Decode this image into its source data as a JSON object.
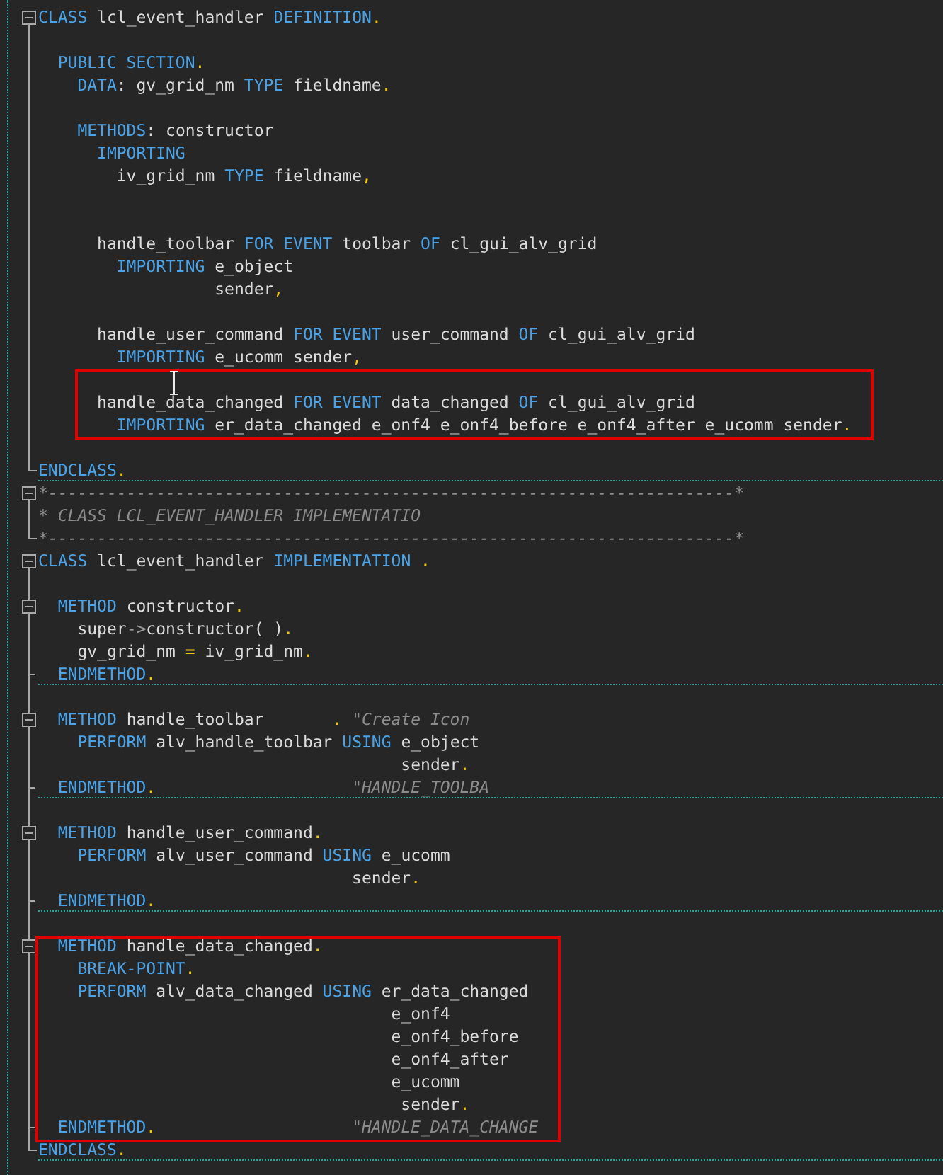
{
  "blocks": [
    {
      "highlighted": false,
      "lines": [
        {
          "kind": "start",
          "separator": false,
          "tokens": [
            {
              "kind": "kw",
              "text": "CLASS"
            },
            {
              "kind": "id",
              "text": " lcl_event_handler "
            },
            {
              "kind": "kw",
              "text": "DEFINITION"
            },
            {
              "kind": "p",
              "text": "."
            }
          ]
        },
        {
          "kind": "line",
          "separator": false
        },
        {
          "kind": "line",
          "separator": false,
          "tokens": [
            {
              "kind": "kw",
              "text": "  PUBLIC SECTION"
            },
            {
              "kind": "p",
              "text": "."
            }
          ]
        },
        {
          "kind": "line",
          "separator": false,
          "tokens": [
            {
              "kind": "kw",
              "text": "    DATA"
            },
            {
              "kind": "id",
              "text": ": gv_grid_nm "
            },
            {
              "kind": "kw",
              "text": "TYPE"
            },
            {
              "kind": "id",
              "text": " fieldname"
            },
            {
              "kind": "p",
              "text": "."
            }
          ]
        },
        {
          "kind": "line",
          "separator": false
        },
        {
          "kind": "line",
          "separator": false,
          "tokens": [
            {
              "kind": "kw",
              "text": "    METHODS"
            },
            {
              "kind": "id",
              "text": ": constructor"
            }
          ]
        },
        {
          "kind": "line",
          "separator": false,
          "tokens": [
            {
              "kind": "kw",
              "text": "      IMPORTING"
            }
          ]
        },
        {
          "kind": "line",
          "separator": false,
          "tokens": [
            {
              "kind": "id",
              "text": "        iv_grid_nm "
            },
            {
              "kind": "kw",
              "text": "TYPE"
            },
            {
              "kind": "id",
              "text": " fieldname"
            },
            {
              "kind": "p",
              "text": ","
            }
          ]
        },
        {
          "kind": "line",
          "separator": false
        },
        {
          "kind": "line",
          "separator": false
        },
        {
          "kind": "line",
          "separator": false,
          "tokens": [
            {
              "kind": "id",
              "text": "      handle_toolbar "
            },
            {
              "kind": "kw",
              "text": "FOR EVENT"
            },
            {
              "kind": "id",
              "text": " toolbar "
            },
            {
              "kind": "kw",
              "text": "OF"
            },
            {
              "kind": "id",
              "text": " cl_gui_alv_grid"
            }
          ]
        },
        {
          "kind": "line",
          "separator": false,
          "tokens": [
            {
              "kind": "kw",
              "text": "        IMPORTING"
            },
            {
              "kind": "id",
              "text": " e_object"
            }
          ]
        },
        {
          "kind": "line",
          "separator": false,
          "tokens": [
            {
              "kind": "id",
              "text": "                  sender"
            },
            {
              "kind": "p",
              "text": ","
            }
          ]
        },
        {
          "kind": "line",
          "separator": false
        },
        {
          "kind": "line",
          "separator": false,
          "tokens": [
            {
              "kind": "id",
              "text": "      handle_user_command "
            },
            {
              "kind": "kw",
              "text": "FOR EVENT"
            },
            {
              "kind": "id",
              "text": " user_command "
            },
            {
              "kind": "kw",
              "text": "OF"
            },
            {
              "kind": "id",
              "text": " cl_gui_alv_grid"
            }
          ]
        },
        {
          "kind": "line",
          "separator": false,
          "tokens": [
            {
              "kind": "kw",
              "text": "        IMPORTING"
            },
            {
              "kind": "id",
              "text": " e_ucomm sender"
            },
            {
              "kind": "p",
              "text": ","
            }
          ]
        }
      ]
    },
    {
      "highlighted": true,
      "lines": [
        {
          "kind": "line",
          "separator": false
        },
        {
          "kind": "line",
          "separator": false,
          "tokens": [
            {
              "kind": "id",
              "text": "      handle_data_changed "
            },
            {
              "kind": "kw",
              "text": "FOR EVENT"
            },
            {
              "kind": "id",
              "text": " data_changed "
            },
            {
              "kind": "kw",
              "text": "OF"
            },
            {
              "kind": "id",
              "text": " cl_gui_alv_grid"
            }
          ]
        },
        {
          "kind": "line",
          "separator": false,
          "tokens": [
            {
              "kind": "kw",
              "text": "        IMPORTING"
            },
            {
              "kind": "id",
              "text": " er_data_changed e_onf4 e_onf4_before e_onf4_after e_ucomm sender"
            },
            {
              "kind": "p",
              "text": "."
            }
          ]
        }
      ]
    },
    {
      "highlighted": false,
      "lines": [
        {
          "kind": "line",
          "separator": false
        },
        {
          "kind": "end",
          "separator": true,
          "tokens": [
            {
              "kind": "kw",
              "text": "ENDCLASS"
            },
            {
              "kind": "p",
              "text": "."
            }
          ]
        },
        {
          "kind": "start",
          "separator": false,
          "tokens": [
            {
              "kind": "cm",
              "text": "*----------------------------------------------------------------------*"
            }
          ]
        },
        {
          "kind": "line",
          "separator": false,
          "tokens": [
            {
              "kind": "cm",
              "text": "* CLASS LCL_EVENT_HANDLER IMPLEMENTATIO"
            }
          ]
        },
        {
          "kind": "end",
          "separator": false,
          "tokens": [
            {
              "kind": "cm",
              "text": "*----------------------------------------------------------------------*"
            }
          ]
        },
        {
          "kind": "start",
          "separator": false,
          "tokens": [
            {
              "kind": "kw",
              "text": "CLASS"
            },
            {
              "kind": "id",
              "text": " lcl_event_handler "
            },
            {
              "kind": "kw",
              "text": "IMPLEMENTATION"
            },
            {
              "kind": "p",
              "text": " ."
            }
          ]
        },
        {
          "kind": "line",
          "separator": false
        },
        {
          "kind": "nested",
          "separator": false,
          "tokens": [
            {
              "kind": "kw",
              "text": "  METHOD"
            },
            {
              "kind": "id",
              "text": " constructor"
            },
            {
              "kind": "p",
              "text": "."
            }
          ]
        },
        {
          "kind": "line",
          "separator": false,
          "tokens": [
            {
              "kind": "id",
              "text": "    super"
            },
            {
              "kind": "op",
              "text": "->"
            },
            {
              "kind": "id",
              "text": "constructor( )"
            },
            {
              "kind": "p",
              "text": "."
            }
          ]
        },
        {
          "kind": "line",
          "separator": false,
          "tokens": [
            {
              "kind": "id",
              "text": "    gv_grid_nm "
            },
            {
              "kind": "p",
              "text": "="
            },
            {
              "kind": "id",
              "text": " iv_grid_nm"
            },
            {
              "kind": "p",
              "text": "."
            }
          ]
        },
        {
          "kind": "tick",
          "separator": true,
          "tokens": [
            {
              "kind": "kw",
              "text": "  ENDMETHOD"
            },
            {
              "kind": "p",
              "text": "."
            }
          ]
        },
        {
          "kind": "line",
          "separator": false
        },
        {
          "kind": "nested",
          "separator": false,
          "tokens": [
            {
              "kind": "kw",
              "text": "  METHOD"
            },
            {
              "kind": "id",
              "text": " handle_toolbar"
            },
            {
              "kind": "p",
              "text": "       ."
            },
            {
              "kind": "cm",
              "text": " \"Create Icon"
            }
          ]
        },
        {
          "kind": "line",
          "separator": false,
          "tokens": [
            {
              "kind": "kw",
              "text": "    PERFORM"
            },
            {
              "kind": "id",
              "text": " alv_handle_toolbar "
            },
            {
              "kind": "kw",
              "text": "USING"
            },
            {
              "kind": "id",
              "text": " e_object"
            }
          ]
        },
        {
          "kind": "line",
          "separator": false,
          "tokens": [
            {
              "kind": "id",
              "text": "                                     sender"
            },
            {
              "kind": "p",
              "text": "."
            }
          ]
        },
        {
          "kind": "tick",
          "separator": true,
          "tokens": [
            {
              "kind": "kw",
              "text": "  ENDMETHOD"
            },
            {
              "kind": "p",
              "text": "."
            },
            {
              "kind": "cm",
              "text": "                    \"HANDLE_TOOLBA"
            }
          ]
        },
        {
          "kind": "line",
          "separator": false
        },
        {
          "kind": "nested",
          "separator": false,
          "tokens": [
            {
              "kind": "kw",
              "text": "  METHOD"
            },
            {
              "kind": "id",
              "text": " handle_user_command"
            },
            {
              "kind": "p",
              "text": "."
            }
          ]
        },
        {
          "kind": "line",
          "separator": false,
          "tokens": [
            {
              "kind": "kw",
              "text": "    PERFORM"
            },
            {
              "kind": "id",
              "text": " alv_user_command "
            },
            {
              "kind": "kw",
              "text": "USING"
            },
            {
              "kind": "id",
              "text": " e_ucomm"
            }
          ]
        },
        {
          "kind": "line",
          "separator": false,
          "tokens": [
            {
              "kind": "id",
              "text": "                                sender"
            },
            {
              "kind": "p",
              "text": "."
            }
          ]
        },
        {
          "kind": "tick",
          "separator": true,
          "tokens": [
            {
              "kind": "kw",
              "text": "  ENDMETHOD"
            },
            {
              "kind": "p",
              "text": "."
            }
          ]
        },
        {
          "kind": "line",
          "separator": false
        }
      ]
    },
    {
      "highlighted": true,
      "lines": [
        {
          "kind": "nested",
          "separator": false,
          "tokens": [
            {
              "kind": "kw",
              "text": "  METHOD"
            },
            {
              "kind": "id",
              "text": " handle_data_changed"
            },
            {
              "kind": "p",
              "text": "."
            }
          ]
        },
        {
          "kind": "line",
          "separator": false,
          "tokens": [
            {
              "kind": "kw",
              "text": "    BREAK-POINT"
            },
            {
              "kind": "p",
              "text": "."
            }
          ]
        },
        {
          "kind": "line",
          "separator": false,
          "tokens": [
            {
              "kind": "kw",
              "text": "    PERFORM"
            },
            {
              "kind": "id",
              "text": " alv_data_changed "
            },
            {
              "kind": "kw",
              "text": "USING"
            },
            {
              "kind": "id",
              "text": " er_data_changed"
            }
          ]
        },
        {
          "kind": "line",
          "separator": false,
          "tokens": [
            {
              "kind": "id",
              "text": "                                    e_onf4"
            }
          ]
        },
        {
          "kind": "line",
          "separator": false,
          "tokens": [
            {
              "kind": "id",
              "text": "                                    e_onf4_before"
            }
          ]
        },
        {
          "kind": "line",
          "separator": false,
          "tokens": [
            {
              "kind": "id",
              "text": "                                    e_onf4_after"
            }
          ]
        },
        {
          "kind": "line",
          "separator": false,
          "tokens": [
            {
              "kind": "id",
              "text": "                                    e_ucomm"
            }
          ]
        },
        {
          "kind": "line",
          "separator": false,
          "tokens": [
            {
              "kind": "id",
              "text": "                                     sender"
            },
            {
              "kind": "p",
              "text": "."
            }
          ]
        },
        {
          "kind": "tick",
          "separator": false,
          "tokens": [
            {
              "kind": "kw",
              "text": "  ENDMETHOD"
            },
            {
              "kind": "p",
              "text": "."
            },
            {
              "kind": "cm",
              "text": "                    \"HANDLE_DATA_CHANGE"
            }
          ]
        }
      ]
    },
    {
      "highlighted": false,
      "lines": [
        {
          "kind": "end",
          "separator": true,
          "tokens": [
            {
              "kind": "kw",
              "text": "ENDCLASS"
            },
            {
              "kind": "p",
              "text": "."
            }
          ]
        }
      ]
    }
  ]
}
